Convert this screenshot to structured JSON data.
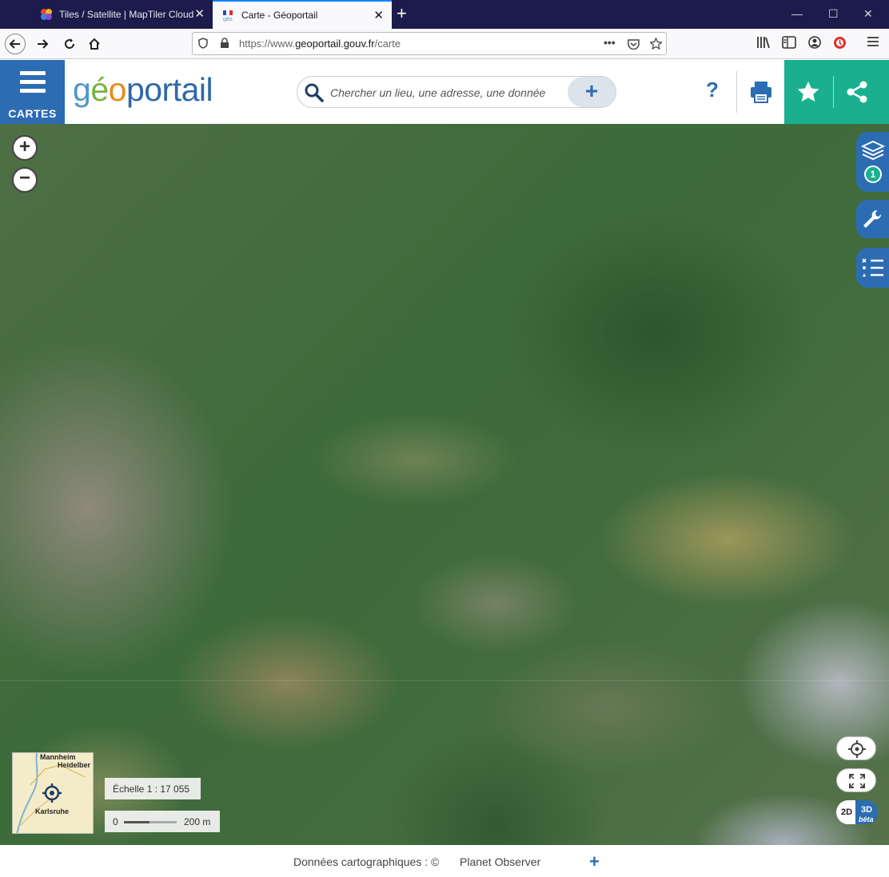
{
  "browser": {
    "tabs": [
      {
        "title": "Tiles / Satellite | MapTiler Cloud",
        "active": false,
        "favicon": "maptiler-icon"
      },
      {
        "title": "Carte - Géoportail",
        "active": true,
        "favicon": "geoportail-icon"
      }
    ],
    "new_tab": "+",
    "close_glyph": "✕",
    "url": {
      "scheme": "https://www.",
      "host": "geoportail.gouv.fr",
      "path": "/carte"
    },
    "window_controls": [
      "—",
      "☐",
      "✕"
    ],
    "page_actions": "•••"
  },
  "header": {
    "menu_label": "CARTES",
    "logo": {
      "part1": "g",
      "part2": "é",
      "part3": "o",
      "part4": "portail"
    },
    "search_placeholder": "Chercher un lieu, une adresse, une donnée",
    "search_add": "+",
    "help": "?"
  },
  "map": {
    "zoom_in": "+",
    "zoom_out": "−",
    "layers_count": "1",
    "minimap_labels": {
      "city1": "Mannheim",
      "city2": "Heidelber",
      "city3": "Karlsruhe"
    },
    "scale_label": "Échelle 1 : 17 055",
    "scale_bar": {
      "zero": "0",
      "distance": "200 m"
    },
    "mode": {
      "two_d": "2D",
      "three_d": "3D",
      "beta": "bêta"
    }
  },
  "footer": {
    "attribution_label": "Données cartographiques : ©",
    "attribution_value": "Planet Observer",
    "more": "+"
  },
  "colors": {
    "brand_blue": "#2b6cb3",
    "accent_green": "#1ab08f",
    "tabbar": "#1c1b4b"
  }
}
